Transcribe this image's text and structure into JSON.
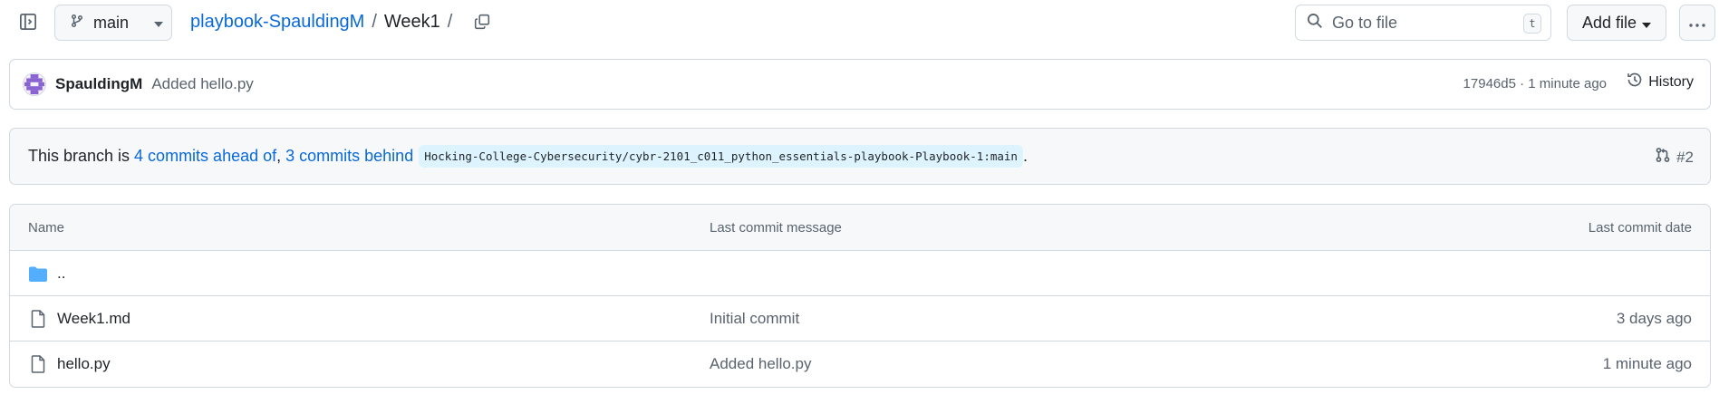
{
  "header": {
    "branch_label": "main",
    "repo_name": "playbook-SpauldingM",
    "separator": "/",
    "current_dir": "Week1",
    "trailing_separator": "/",
    "search_placeholder": "Go to file",
    "search_shortcut": "t",
    "add_file_label": "Add file"
  },
  "latest_commit": {
    "author": "SpauldingM",
    "message": "Added hello.py",
    "meta": "17946d5 · 1 minute ago",
    "history_label": "History"
  },
  "branch_status": {
    "prefix": "This branch is ",
    "ahead": "4 commits ahead of",
    "comma": ", ",
    "behind": "3 commits behind",
    "upstream": "Hocking-College-Cybersecurity/cybr-2101_c011_python_essentials-playbook-Playbook-1:main",
    "suffix": ".",
    "pr_label": "#2"
  },
  "table": {
    "headers": {
      "name": "Name",
      "message": "Last commit message",
      "date": "Last commit date"
    },
    "rows": [
      {
        "type": "parent",
        "name": "..",
        "message": "",
        "date": ""
      },
      {
        "type": "file",
        "name": "Week1.md",
        "message": "Initial commit",
        "date": "3 days ago"
      },
      {
        "type": "file",
        "name": "hello.py",
        "message": "Added hello.py",
        "date": "1 minute ago"
      }
    ]
  },
  "colors": {
    "link": "#0969da",
    "muted": "#59636e",
    "border": "#d1d9e0",
    "folder": "#54aeff",
    "upstream_bg": "#ddf4ff"
  }
}
